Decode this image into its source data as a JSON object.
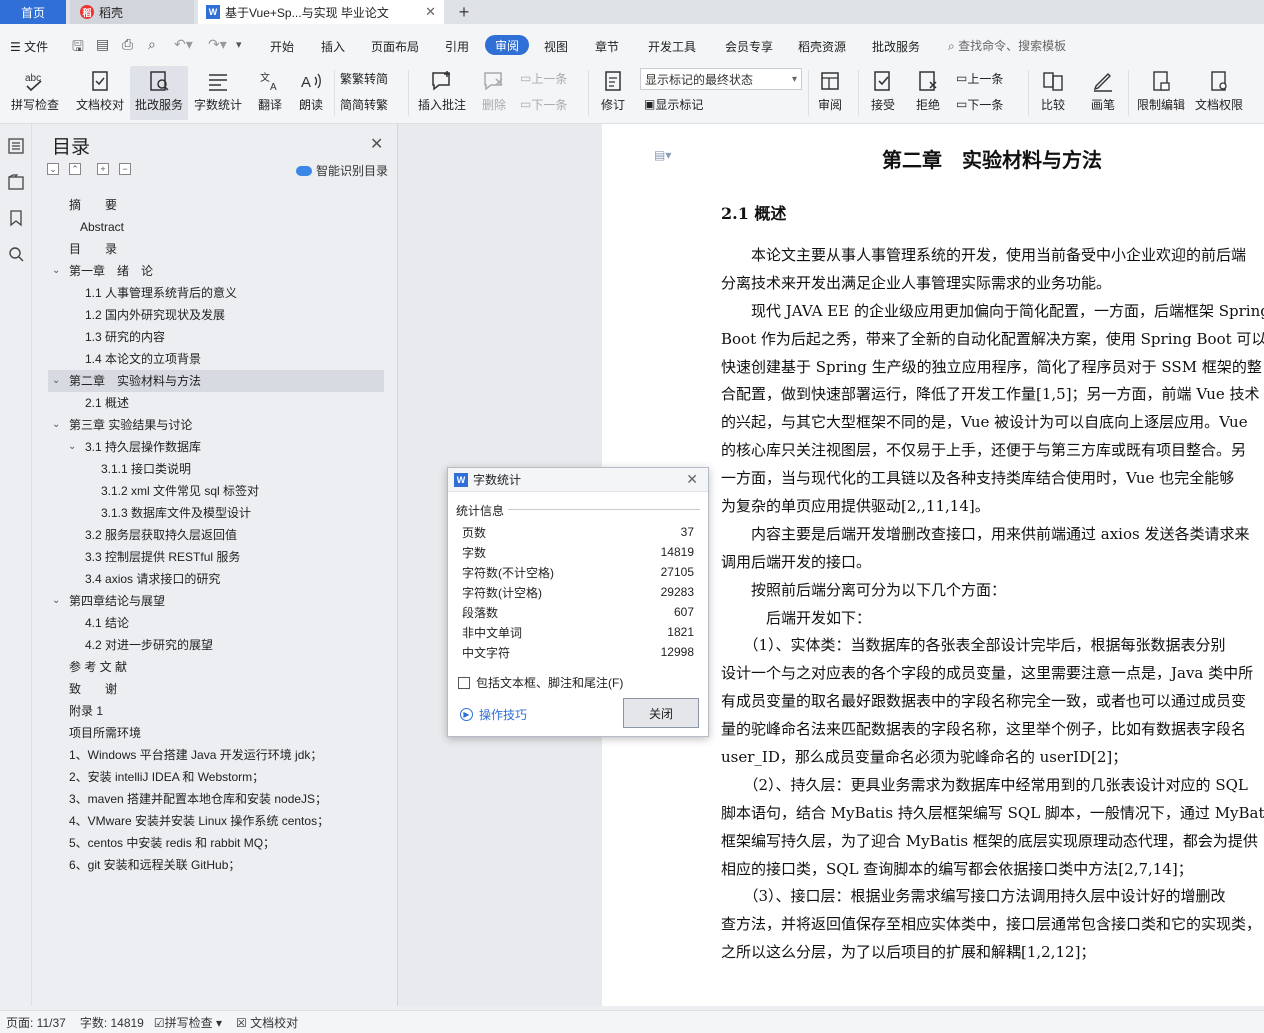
{
  "tabs": {
    "home": "首页",
    "daoke": "稻壳",
    "document": "基于Vue+Sp...与实现 毕业论文"
  },
  "menu": {
    "file": "文件",
    "items": [
      "开始",
      "插入",
      "页面布局",
      "引用",
      "审阅",
      "视图",
      "章节",
      "开发工具",
      "会员专享",
      "稻壳资源",
      "批改服务"
    ],
    "active": "审阅",
    "search": "查找命令、搜索模板"
  },
  "ribbon": {
    "spell_check": "拼写检查",
    "doc_proof": "文档校对",
    "correction": "批改服务",
    "word_count": "字数统计",
    "translate": "翻译",
    "read_aloud": "朗读",
    "to_traditional": "繁转简",
    "to_simplified": "简转繁",
    "insert_comment": "插入批注",
    "delete": "删除",
    "prev": "上一条",
    "next": "下一条",
    "revise": "修订",
    "markup_state": "显示标记的最终状态",
    "show_markup": "显示标记",
    "review": "审阅",
    "accept": "接受",
    "reject": "拒绝",
    "prev2": "上一条",
    "next2": "下一条",
    "compare": "比较",
    "pen": "画笔",
    "restrict_edit": "限制编辑",
    "doc_permission": "文档权限"
  },
  "toc": {
    "title": "目录",
    "smart": "智能识别目录",
    "items": [
      {
        "label": "摘　　要"
      },
      {
        "label": "Abstract"
      },
      {
        "label": "目　　录"
      },
      {
        "label": "第一章　绪　论"
      },
      {
        "label": "1.1  人事管理系统背后的意义"
      },
      {
        "label": "1.2  国内外研究现状及发展"
      },
      {
        "label": "1.3  研究的内容"
      },
      {
        "label": "1.4  本论文的立项背景"
      },
      {
        "label": "第二章　实验材料与方法"
      },
      {
        "label": "2.1  概述"
      },
      {
        "label": "第三章  实验结果与讨论"
      },
      {
        "label": "3.1  持久层操作数据库"
      },
      {
        "label": "3.1.1  接口类说明"
      },
      {
        "label": "3.1.2    xml 文件常见 sql 标签对"
      },
      {
        "label": "3.1.3    数据库文件及模型设计"
      },
      {
        "label": "3.2  服务层获取持久层返回值"
      },
      {
        "label": "3.3  控制层提供 RESTful 服务"
      },
      {
        "label": "3.4 axios 请求接口的研究"
      },
      {
        "label": "第四章结论与展望"
      },
      {
        "label": "4.1  结论"
      },
      {
        "label": "4.2  对进一步研究的展望"
      },
      {
        "label": "参 考 文 献"
      },
      {
        "label": "致　　谢"
      },
      {
        "label": "附录 1"
      },
      {
        "label": "项目所需环境"
      },
      {
        "label": "1、Windows 平台搭建 Java 开发运行环境 jdk；"
      },
      {
        "label": "2、安装 intelliJ IDEA 和 Webstorm；"
      },
      {
        "label": "3、maven 搭建并配置本地仓库和安装 nodeJS；"
      },
      {
        "label": "4、VMware 安装并安装 Linux 操作系统 centos；"
      },
      {
        "label": "5、centos 中安装 redis 和 rabbit MQ；"
      },
      {
        "label": "6、git 安装和远程关联 GitHub；"
      }
    ]
  },
  "document": {
    "chapter_title": "第二章　实验材料与方法",
    "section_title": "2.1  概述",
    "lines": [
      "　　本论文主要从事人事管理系统的开发，使用当前备受中小企业欢迎的前后端",
      "分离技术来开发出满足企业人事管理实际需求的业务功能。",
      "　　现代 JAVA EE 的企业级应用更加偏向于简化配置，一方面，后端框架 Spring",
      "Boot 作为后起之秀，带来了全新的自动化配置解决方案，使用 Spring Boot 可以",
      "快速创建基于 Spring 生产级的独立应用程序，简化了程序员对于 SSM 框架的整",
      "合配置，做到快速部署运行，降低了开发工作量[1,5]；另一方面，前端 Vue 技术",
      "的兴起，与其它大型框架不同的是，Vue 被设计为可以自底向上逐层应用。Vue",
      "的核心库只关注视图层，不仅易于上手，还便于与第三方库或既有项目整合。另",
      "一方面，当与现代化的工具链以及各种支持类库结合使用时，Vue 也完全能够",
      "为复杂的单页应用提供驱动[2,,11,14]。",
      "　　内容主要是后端开发增删改查接口，用来供前端通过 axios 发送各类请求来",
      "调用后端开发的接口。",
      "　　按照前后端分离可分为以下几个方面：",
      "　　　后端开发如下：",
      "　　（1）、实体类：当数据库的各张表全部设计完毕后，根据每张数据表分别",
      "设计一个与之对应表的各个字段的成员变量，这里需要注意一点是，Java 类中所",
      "有成员变量的取名最好跟数据表中的字段名称完全一致，或者也可以通过成员变",
      "量的驼峰命名法来匹配数据表的字段名称，这里举个例子，比如有数据表字段名",
      "user_ID，那么成员变量命名必须为驼峰命名的 userID[2]；",
      "　　（2）、持久层：更具业务需求为数据库中经常用到的几张表设计对应的 SQL",
      "脚本语句，结合 MyBatis 持久层框架编写 SQL 脚本，一般情况下，通过 MyBatis",
      "框架编写持久层，为了迎合 MyBatis 框架的底层实现原理动态代理，都会为提供",
      "相应的接口类，SQL 查询脚本的编写都会依据接口类中方法[2,7,14]；",
      "　　（3）、接口层：根据业务需求编写接口方法调用持久层中设计好的增删改",
      "查方法，并将返回值保存至相应实体类中，接口层通常包含接口类和它的实现类，",
      "之所以这么分层，为了以后项目的扩展和解耦[1,2,12]；"
    ]
  },
  "dialog": {
    "title": "字数统计",
    "section": "统计信息",
    "stats": [
      {
        "label": "页数",
        "value": "37"
      },
      {
        "label": "字数",
        "value": "14819"
      },
      {
        "label": "字符数(不计空格)",
        "value": "27105"
      },
      {
        "label": "字符数(计空格)",
        "value": "29283"
      },
      {
        "label": "段落数",
        "value": "607"
      },
      {
        "label": "非中文单词",
        "value": "1821"
      },
      {
        "label": "中文字符",
        "value": "12998"
      }
    ],
    "checkbox": "包括文本框、脚注和尾注(F)",
    "tips": "操作技巧",
    "close": "关闭"
  },
  "status": {
    "page": "页面: 11/37",
    "words": "字数: 14819",
    "spell": "拼写检查",
    "proof": "文档校对"
  },
  "colors": {
    "accent": "#2f6fd6",
    "page": "#ffffff",
    "panel": "#eceef1"
  }
}
